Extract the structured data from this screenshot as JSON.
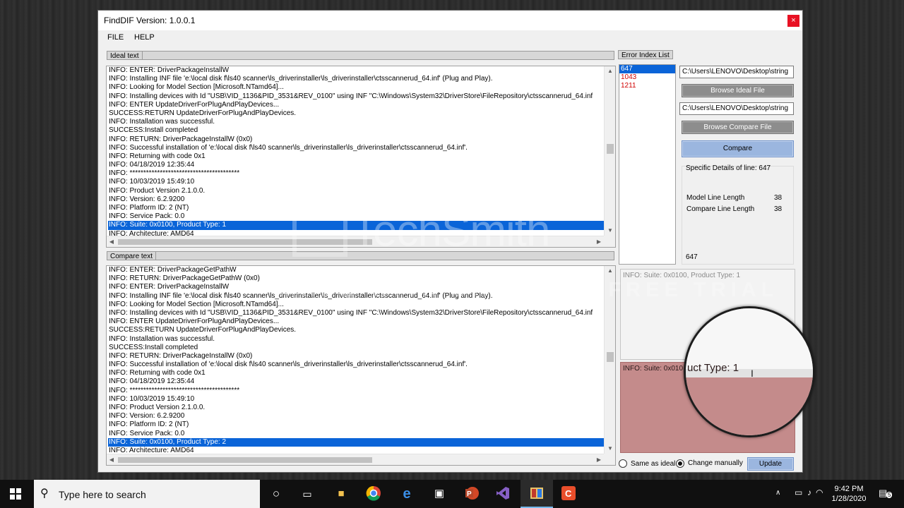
{
  "window": {
    "title": "FindDIF Version: 1.0.0.1",
    "close_glyph": "×"
  },
  "menu": {
    "file": "FILE",
    "help": "HELP"
  },
  "ideal": {
    "label": "Ideal text",
    "lines": [
      "INFO:   ENTER:  DriverPackageInstallW",
      "INFO:   Installing INF file 'e:\\local disk f\\ls40 scanner\\ls_driverinstaller\\ls_driverinstaller\\ctsscannerud_64.inf' (Plug and Play).",
      "INFO:   Looking for Model Section [Microsoft.NTamd64]...",
      "INFO:   Installing devices with Id \"USB\\VID_1136&PID_3531&REV_0100\" using INF \"C:\\Windows\\System32\\DriverStore\\FileRepository\\ctsscannerud_64.inf",
      "INFO:   ENTER UpdateDriverForPlugAndPlayDevices...",
      "SUCCESS:RETURN UpdateDriverForPlugAndPlayDevices.",
      "INFO:   Installation was successful.",
      "SUCCESS:Install completed",
      "INFO:   RETURN: DriverPackageInstallW  (0x0)",
      "INFO:   Successful installation of 'e:\\local disk f\\ls40 scanner\\ls_driverinstaller\\ls_driverinstaller\\ctsscannerud_64.inf'.",
      "INFO:   Returning with code 0x1",
      "INFO:   04/18/2019 12:35:44",
      "INFO:   ****************************************",
      "INFO:   10/03/2019 15:49:10",
      "INFO:   Product Version 2.1.0.0.",
      "INFO:   Version: 6.2.9200",
      "INFO:   Platform ID: 2 (NT)",
      "INFO:   Service Pack: 0.0",
      "INFO:   Suite: 0x0100, Product Type: 1",
      "INFO:   Architecture: AMD64"
    ],
    "selected_index": 18
  },
  "compare": {
    "label": "Compare text",
    "lines": [
      "INFO:   ENTER:  DriverPackageGetPathW",
      "INFO:   RETURN: DriverPackageGetPathW  (0x0)",
      "INFO:   ENTER:  DriverPackageInstallW",
      "INFO:   Installing INF file 'e:\\local disk f\\ls40 scanner\\ls_driverinstaller\\ls_driverinstaller\\ctsscannerud_64.inf' (Plug and Play).",
      "INFO:   Looking for Model Section [Microsoft.NTamd64]...",
      "INFO:   Installing devices with Id \"USB\\VID_1136&PID_3531&REV_0100\" using INF \"C:\\Windows\\System32\\DriverStore\\FileRepository\\ctsscannerud_64.inf",
      "INFO:   ENTER UpdateDriverForPlugAndPlayDevices...",
      "SUCCESS:RETURN UpdateDriverForPlugAndPlayDevices.",
      "INFO:   Installation was successful.",
      "SUCCESS:Install completed",
      "INFO:   RETURN: DriverPackageInstallW  (0x0)",
      "INFO:   Successful installation of 'e:\\local disk f\\ls40 scanner\\ls_driverinstaller\\ls_driverinstaller\\ctsscannerud_64.inf'.",
      "INFO:   Returning with code 0x1",
      "INFO:   04/18/2019 12:35:44",
      "INFO:   ****************************************",
      "INFO:   10/03/2019 15:49:10",
      "INFO:   Product Version 2.1.0.0.",
      "INFO:   Version: 6.2.9200",
      "INFO:   Platform ID: 2 (NT)",
      "INFO:   Service Pack: 0.0",
      "INFO:   Suite: 0x0100, Product Type: 2",
      "INFO:   Architecture: AMD64"
    ],
    "selected_index": 20
  },
  "error_index": {
    "label": "Error Index List",
    "items": [
      "647",
      "1043",
      "1211"
    ],
    "selected_index": 0
  },
  "ideal_path": "C:\\Users\\LENOVO\\Desktop\\string",
  "browse_ideal": "Browse Ideal File",
  "compare_path": "C:\\Users\\LENOVO\\Desktop\\string",
  "browse_compare": "Browse Compare File",
  "compare_button": "Compare",
  "details": {
    "heading": "Specific Details of line: 647",
    "model_label": "Model Line Length",
    "model_value": "38",
    "compare_label": "Compare Line Length",
    "compare_value": "38",
    "line_number": "647"
  },
  "ideal_line_text": "INFO:   Suite: 0x0100, Product Type: 1",
  "compare_line_text": "INFO:   Suite: 0x010",
  "magnified_text": "uct Type: 1",
  "options": {
    "same_as_ideal": "Same as ideal",
    "change_manually": "Change manually",
    "selected": "change_manually"
  },
  "update_button": "Update",
  "watermark": {
    "brand": "TechSmith",
    "registered": "®",
    "tagline": "MADE WITH CAMTASIA FREE TRIAL"
  },
  "taskbar": {
    "search_placeholder": "Type here to search",
    "search_icon": "search-icon",
    "apps": [
      "cortana-icon",
      "task-view-icon",
      "file-explorer-icon",
      "chrome-icon",
      "edge-icon",
      "store-icon",
      "powerpoint-icon",
      "visual-studio-icon",
      "finddif-icon",
      "camtasia-icon"
    ],
    "time": "9:42 PM",
    "date": "1/28/2020",
    "notification_count": "5"
  }
}
